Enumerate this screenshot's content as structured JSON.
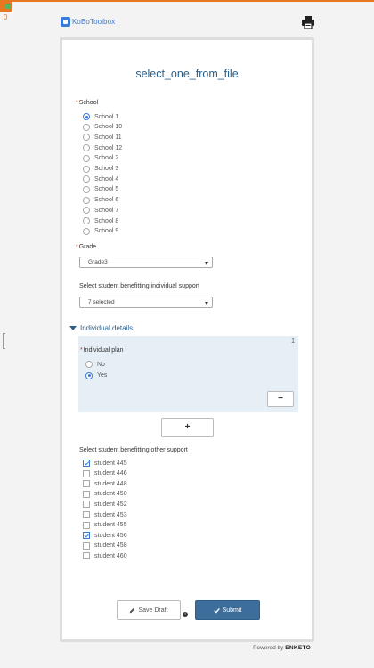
{
  "app": {
    "logo_text": "KoBoToolbox",
    "corner_count": "0"
  },
  "form": {
    "title": "select_one_from_file"
  },
  "school": {
    "label": "School",
    "required": "*",
    "options": [
      "School 1",
      "School 10",
      "School 11",
      "School 12",
      "School 2",
      "School 3",
      "School 4",
      "School 5",
      "School 6",
      "School 7",
      "School 8",
      "School 9"
    ],
    "selected": "School 1"
  },
  "grade": {
    "label": "Grade",
    "required": "*",
    "value": "Grade3"
  },
  "individual_support": {
    "label": "Select student benefitting individual support",
    "value": "7 selected"
  },
  "group": {
    "title": "Individual details",
    "repeat_index": "1",
    "plan": {
      "label": "Individual plan",
      "required": "*",
      "options": [
        "No",
        "Yes"
      ],
      "selected": "Yes"
    },
    "remove_label": "−",
    "add_label": "+"
  },
  "other_support": {
    "label": "Select student benefitting other support",
    "options": [
      "student 445",
      "student 446",
      "student 448",
      "student 450",
      "student 452",
      "student 453",
      "student 455",
      "student 456",
      "student 458",
      "student 460"
    ],
    "checked": [
      "student 445",
      "student 456"
    ]
  },
  "actions": {
    "save_draft": "Save Draft",
    "submit": "Submit",
    "info": "i"
  },
  "footer": {
    "powered_by": "Powered by",
    "brand": "ENKETO"
  },
  "colors": {
    "accent": "#e87722",
    "primary": "#3d6d9a",
    "title": "#2c5f8a",
    "repeat_bg": "#e6eff5"
  },
  "icons": [
    "print-icon",
    "pencil-icon",
    "check-icon",
    "info-icon",
    "caret-down-icon",
    "triangle-down-icon"
  ]
}
